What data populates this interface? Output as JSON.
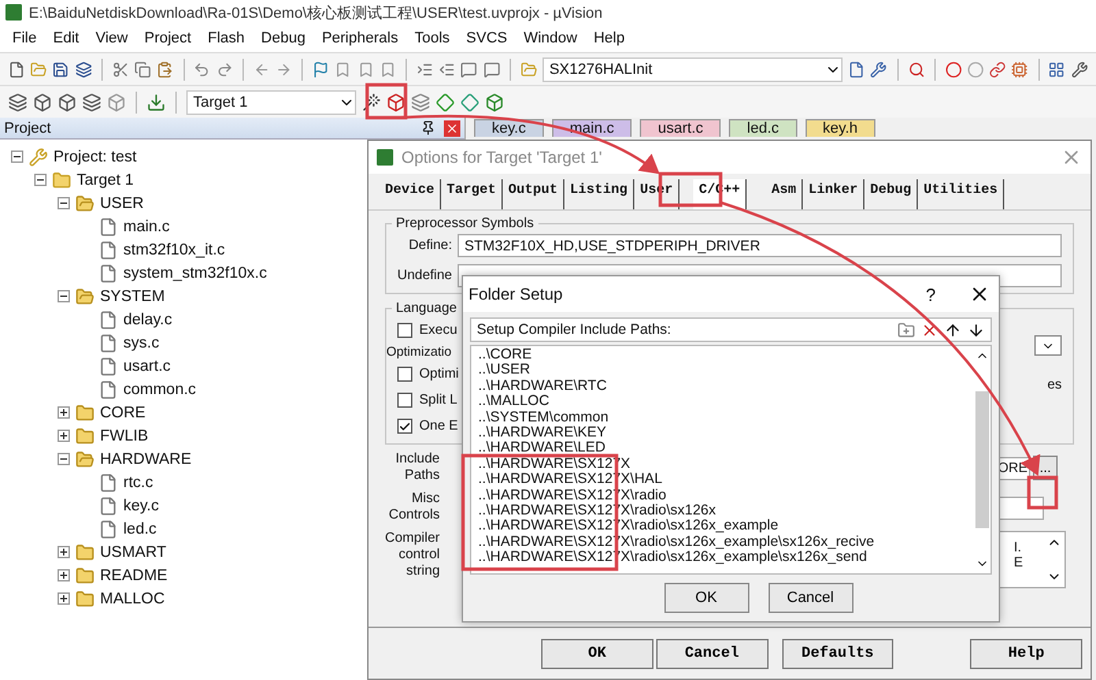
{
  "window": {
    "title": "E:\\BaiduNetdiskDownload\\Ra-01S\\Demo\\核心板测试工程\\USER\\test.uvprojx - µVision"
  },
  "menu": [
    "File",
    "Edit",
    "View",
    "Project",
    "Flash",
    "Debug",
    "Peripherals",
    "Tools",
    "SVCS",
    "Window",
    "Help"
  ],
  "toolbar": {
    "function_combo": "SX1276HALInit"
  },
  "target_toolbar": {
    "target_combo": "Target 1"
  },
  "project_panel": {
    "title": "Project",
    "tree": [
      {
        "label": "Project: test",
        "kind": "project",
        "expanded": true,
        "children": [
          {
            "label": "Target 1",
            "kind": "target",
            "expanded": true,
            "children": [
              {
                "label": "USER",
                "kind": "folder",
                "expanded": true,
                "children": [
                  {
                    "label": "main.c",
                    "kind": "file"
                  },
                  {
                    "label": "stm32f10x_it.c",
                    "kind": "file"
                  },
                  {
                    "label": "system_stm32f10x.c",
                    "kind": "file"
                  }
                ]
              },
              {
                "label": "SYSTEM",
                "kind": "folder",
                "expanded": true,
                "children": [
                  {
                    "label": "delay.c",
                    "kind": "file"
                  },
                  {
                    "label": "sys.c",
                    "kind": "file"
                  },
                  {
                    "label": "usart.c",
                    "kind": "file"
                  },
                  {
                    "label": "common.c",
                    "kind": "file"
                  }
                ]
              },
              {
                "label": "CORE",
                "kind": "folder",
                "expanded": false
              },
              {
                "label": "FWLIB",
                "kind": "folder",
                "expanded": false
              },
              {
                "label": "HARDWARE",
                "kind": "folder",
                "expanded": true,
                "children": [
                  {
                    "label": "rtc.c",
                    "kind": "file"
                  },
                  {
                    "label": "key.c",
                    "kind": "file"
                  },
                  {
                    "label": "led.c",
                    "kind": "file"
                  }
                ]
              },
              {
                "label": "USMART",
                "kind": "folder",
                "expanded": false
              },
              {
                "label": "README",
                "kind": "folder",
                "expanded": false
              },
              {
                "label": "MALLOC",
                "kind": "folder",
                "expanded": false
              }
            ]
          }
        ]
      }
    ]
  },
  "editor_tabs": [
    {
      "label": "key.c",
      "color": "#c9d3e3",
      "selected": false
    },
    {
      "label": "main.c",
      "color": "#cdbde8",
      "selected": false
    },
    {
      "label": "usart.c",
      "color": "#f0c4cf",
      "selected": false
    },
    {
      "label": "led.c",
      "color": "#cfe3c2",
      "selected": false
    },
    {
      "label": "key.h",
      "color": "#f2dc8e",
      "selected": false
    }
  ],
  "options_dialog": {
    "title": "Options for Target 'Target 1'",
    "tabs": [
      {
        "label": "Device",
        "selected": false
      },
      {
        "label": "Target",
        "selected": false
      },
      {
        "label": "Output",
        "selected": false
      },
      {
        "label": "Listing",
        "selected": false
      },
      {
        "label": "User",
        "selected": false
      },
      {
        "label": "C/C++",
        "selected": true
      },
      {
        "label": "Asm",
        "selected": false
      },
      {
        "label": "Linker",
        "selected": false
      },
      {
        "label": "Debug",
        "selected": false
      },
      {
        "label": "Utilities",
        "selected": false
      }
    ],
    "preprocessor": {
      "title": "Preprocessor Symbols",
      "define_label": "Define:",
      "define_value": "STM32F10X_HD,USE_STDPERIPH_DRIVER",
      "undefine_label": "Undefine"
    },
    "language": {
      "title": "Language",
      "options": [
        {
          "kind": "checkbox",
          "label": "Execu",
          "checked": false
        },
        {
          "kind": "heading",
          "label": "Optimizatio"
        },
        {
          "kind": "checkbox",
          "label": "Optimi",
          "checked": false
        },
        {
          "kind": "checkbox",
          "label": "Split L",
          "checked": false
        },
        {
          "kind": "checkbox",
          "label": "One E",
          "checked": true
        }
      ],
      "side_text": "es"
    },
    "include_paths": {
      "label": "Include Paths",
      "value": "ORE",
      "browse": "..."
    },
    "misc_controls": {
      "label": "Misc Controls"
    },
    "compiler_string": {
      "label": "Compiler control string",
      "lines": [
        "I.",
        "E"
      ]
    },
    "buttons": [
      "OK",
      "Cancel",
      "Defaults",
      "Help"
    ]
  },
  "folder_setup": {
    "title": "Folder Setup",
    "help": "?",
    "list_label": "Setup Compiler Include Paths:",
    "paths": [
      "..\\CORE",
      "..\\USER",
      "..\\HARDWARE\\RTC",
      "..\\MALLOC",
      "..\\SYSTEM\\common",
      "..\\HARDWARE\\KEY",
      "..\\HARDWARE\\LED",
      "..\\HARDWARE\\SX127X",
      "..\\HARDWARE\\SX127X\\HAL",
      "..\\HARDWARE\\SX127X\\radio",
      "..\\HARDWARE\\SX127X\\radio\\sx126x",
      "..\\HARDWARE\\SX127X\\radio\\sx126x_example",
      "..\\HARDWARE\\SX127X\\radio\\sx126x_example\\sx126x_recive",
      "..\\HARDWARE\\SX127X\\radio\\sx126x_example\\sx126x_send"
    ],
    "buttons": [
      "OK",
      "Cancel"
    ]
  }
}
